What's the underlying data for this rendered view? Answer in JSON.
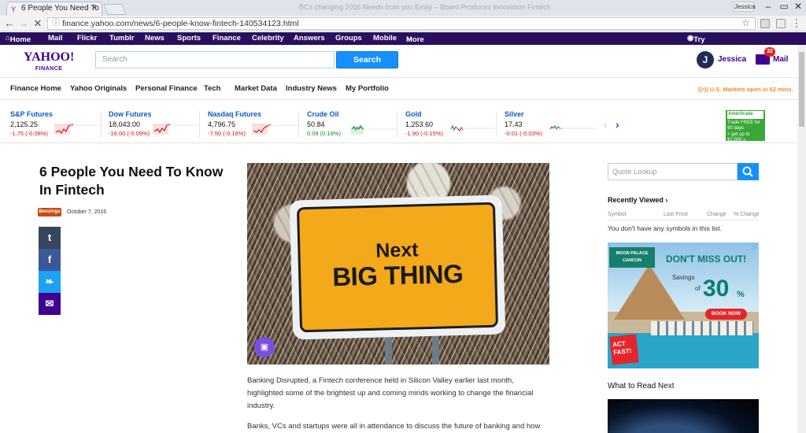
{
  "browser": {
    "tab_title": "6 People You Need To K",
    "blurred_title": "BCs changing 2016 Needs from you Emily – Board Produces Innovation Fintech",
    "address": "finance.yahoo.com/news/6-people-know-fintech-140534123.html",
    "window_user": "Jessica"
  },
  "topbar": {
    "home": "Home",
    "items": [
      "Mail",
      "Flickr",
      "Tumblr",
      "News",
      "Sports",
      "Finance",
      "Celebrity",
      "Answers",
      "Groups",
      "Mobile",
      "More"
    ],
    "firefox_promo": "Try Yahoo Finance on Firefox »"
  },
  "header": {
    "logo_main": "YAHOO!",
    "logo_sub": "FINANCE",
    "search_placeholder": "Search",
    "search_button": "Search",
    "avatar_letter": "J",
    "user_name": "Jessica",
    "mail_count": "32",
    "mail_label": "Mail"
  },
  "subnav": {
    "items": [
      "Finance Home",
      "Yahoo Originals",
      "Personal Finance",
      "Tech",
      "Market Data",
      "Industry News",
      "My Portfolio"
    ],
    "market_status": "U.S. Markets open in 52 mins."
  },
  "tickers": [
    {
      "name": "S&P Futures",
      "price": "2,125.25",
      "change": "-1.75 (-0.08%)",
      "dir": "down"
    },
    {
      "name": "Dow Futures",
      "price": "18,043.00",
      "change": "-16.00 (-0.09%)",
      "dir": "down"
    },
    {
      "name": "Nasdaq Futures",
      "price": "4,796.75",
      "change": "-7.50 (-0.16%)",
      "dir": "down"
    },
    {
      "name": "Crude Oil",
      "price": "50.84",
      "change": "0.09 (0.18%)",
      "dir": "up"
    },
    {
      "name": "Gold",
      "price": "1,253.60",
      "change": "-1.90 (-0.15%)",
      "dir": "down"
    },
    {
      "name": "Silver",
      "price": "17.43",
      "change": "-0.01 (-0.03%)",
      "dir": "down"
    }
  ],
  "ticker_ad": {
    "brand": "Ameritrade",
    "line1": "Trade FREE for 90 days",
    "line2": "+ get up to $1,000 »"
  },
  "article": {
    "title": "6 People You Need To Know In Fintech",
    "author_logo": "Benzinga",
    "date": "October 7, 2016",
    "share_icons": [
      "t",
      "f",
      "❧",
      "✉"
    ],
    "image": {
      "line1": "Next",
      "line2": "BIG THING"
    },
    "paragraphs": [
      "Banking Disrupted, a Fintech conference held in Silicon Valley earlier last month, highlighted some of the brightest up and coming minds working to change the financial industry.",
      "Banks, VCs and startups were all in attendance to discuss the future of banking and how"
    ]
  },
  "sidebar": {
    "quote_placeholder": "Quote Lookup",
    "recently_viewed": "Recently Viewed",
    "col_symbol": "Symbol",
    "col_last_price": "Last Price",
    "col_change": "Change",
    "col_pct_change": "% Change",
    "empty_message": "You don't have any symbols in this list.",
    "ad": {
      "brand": "MOON PALACE CANCUN",
      "headline": "DON'T MISS OUT!",
      "savings": "Savings",
      "of": "of",
      "percent": "30",
      "percent_sign": "%",
      "button": "BOOK NOW",
      "act_fast": "ACT FAST!"
    },
    "what_to_read": "What to Read Next"
  },
  "colors": {
    "purple_bar": "#2a0f5f",
    "brand_purple": "#400090",
    "search_blue": "#188fff",
    "down_red": "#d01414",
    "up_green": "#0b8c2f"
  }
}
